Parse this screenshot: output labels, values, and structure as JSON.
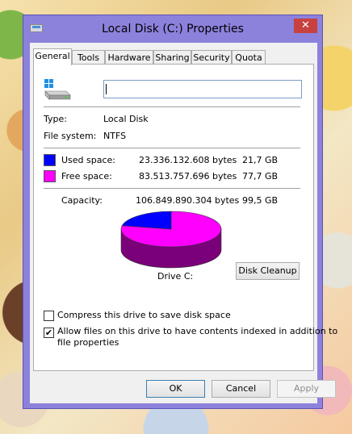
{
  "window": {
    "title": "Local Disk (C:) Properties",
    "close_glyph": "✕"
  },
  "tabs": [
    "General",
    "Tools",
    "Hardware",
    "Sharing",
    "Security",
    "Quota"
  ],
  "general": {
    "name_value": "",
    "type_label": "Type:",
    "type_value": "Local Disk",
    "fs_label": "File system:",
    "fs_value": "NTFS",
    "used": {
      "label": "Used space:",
      "bytes": "23.336.132.608 bytes",
      "size": "21,7 GB",
      "color": "#0000ff"
    },
    "free": {
      "label": "Free space:",
      "bytes": "83.513.757.696 bytes",
      "size": "77,7 GB",
      "color": "#ff00ff"
    },
    "capacity": {
      "label": "Capacity:",
      "bytes": "106.849.890.304 bytes",
      "size": "99,5 GB"
    },
    "drive_label": "Drive C:",
    "used_fraction": 0.2184,
    "disk_cleanup": "Disk Cleanup",
    "compress": {
      "label": "Compress this drive to save disk space",
      "checked": false
    },
    "index": {
      "label_line1": "Allow files on this drive to have contents indexed in addition to",
      "label_line2": "file properties",
      "checked": true,
      "mark": "✔"
    }
  },
  "buttons": {
    "ok": "OK",
    "cancel": "Cancel",
    "apply": "Apply"
  },
  "colors": {
    "window_frame": "#8c82dc",
    "close": "#c7413f",
    "used_dark": "#00007a",
    "free_dark": "#7a007a"
  }
}
